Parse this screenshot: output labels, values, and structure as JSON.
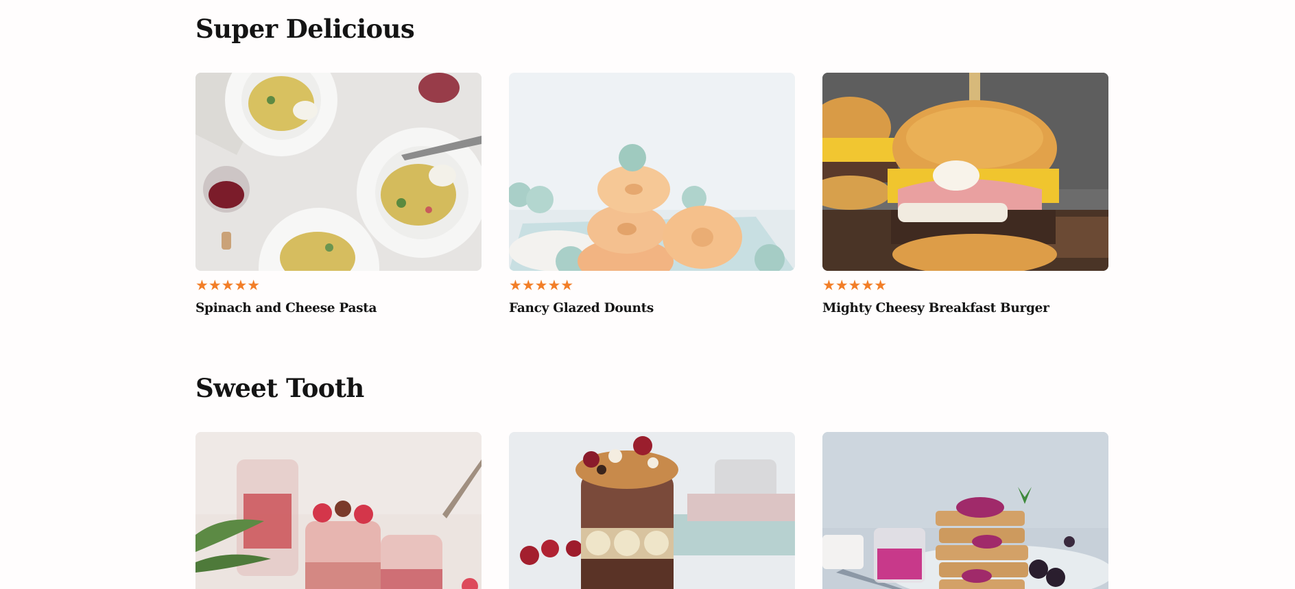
{
  "sections": [
    {
      "title": "Super Delicious",
      "cards": [
        {
          "title": "Spinach and Cheese Pasta",
          "rating": 5,
          "stars": "★★★★★",
          "image": "pasta-photo"
        },
        {
          "title": "Fancy Glazed Dounts",
          "rating": 5,
          "stars": "★★★★★",
          "image": "glazed-donuts-photo"
        },
        {
          "title": "Mighty Cheesy Breakfast Burger",
          "rating": 5,
          "stars": "★★★★★",
          "image": "breakfast-burger-photo"
        }
      ]
    },
    {
      "title": "Sweet Tooth",
      "cards": [
        {
          "image": "berry-parfait-photo"
        },
        {
          "image": "chocolate-banana-jar-photo"
        },
        {
          "image": "berry-waffle-stack-photo"
        }
      ]
    }
  ],
  "colors": {
    "star": "#f27e28",
    "text": "#141414",
    "background": "#fffdfd"
  }
}
